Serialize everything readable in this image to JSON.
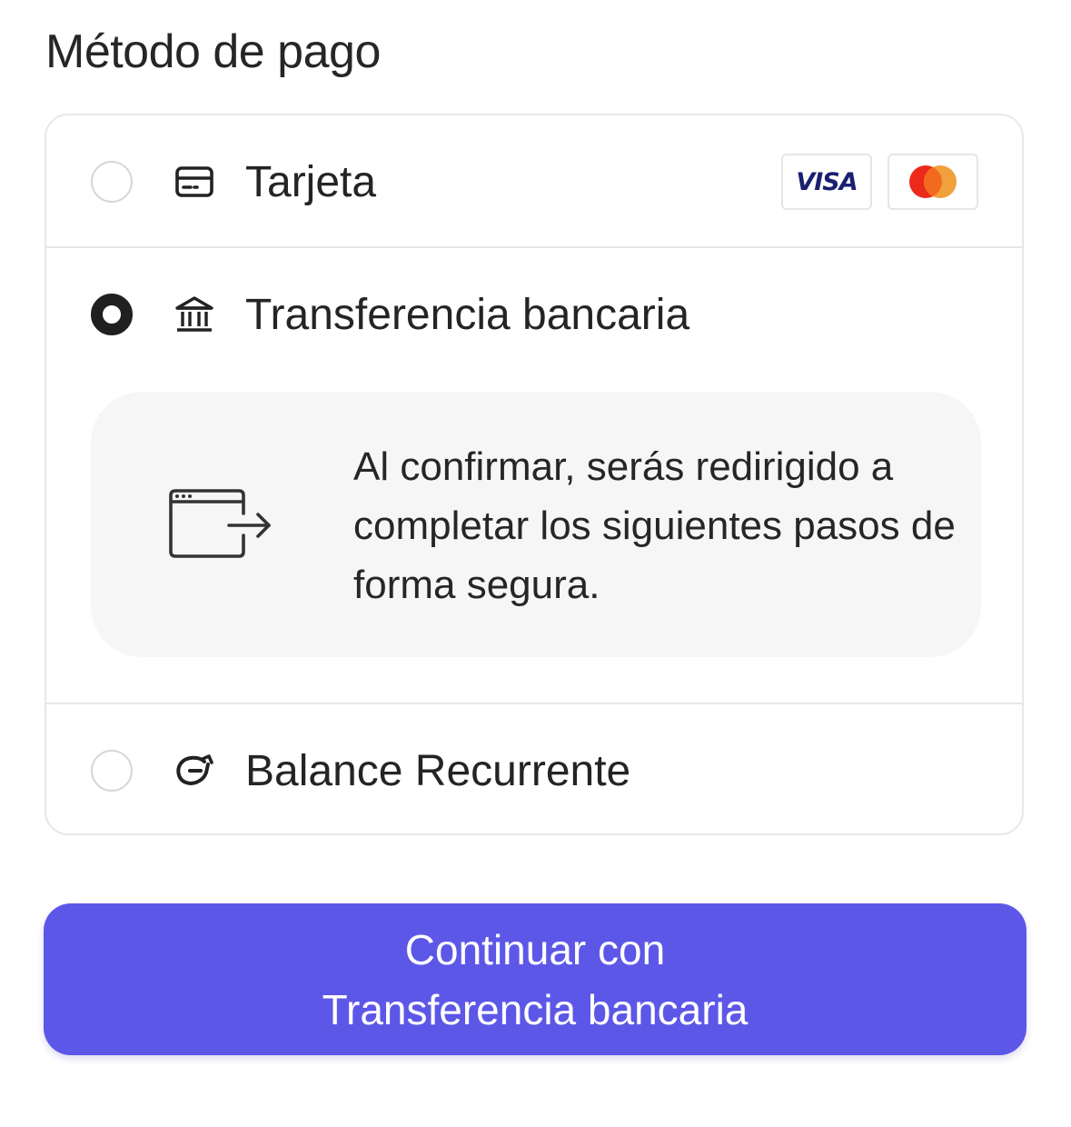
{
  "page": {
    "title": "Método de pago"
  },
  "methods": [
    {
      "id": "card",
      "label": "Tarjeta",
      "icon": "credit-card-icon",
      "selected": false,
      "brands": [
        {
          "name": "visa-logo",
          "text": "VISA",
          "color": "#1a1f71"
        },
        {
          "name": "mastercard-logo",
          "colors": [
            "#eb001b",
            "#f79e1b"
          ]
        }
      ]
    },
    {
      "id": "bank_transfer",
      "label": "Transferencia bancaria",
      "icon": "bank-icon",
      "selected": true,
      "info": {
        "icon": "browser-redirect-icon",
        "text": "Al confirmar, serás redirigido a completar los siguientes pasos de forma segura."
      }
    },
    {
      "id": "recurring_balance",
      "label": "Balance Recurrente",
      "icon": "recurring-balance-icon",
      "selected": false
    }
  ],
  "cta": {
    "label": "Continuar con Transferencia bancaria"
  },
  "colors": {
    "accent": "#5d57e8",
    "border": "#e7e7e7",
    "info_background": "#f6f6f6",
    "radio_selected": "#202020"
  }
}
